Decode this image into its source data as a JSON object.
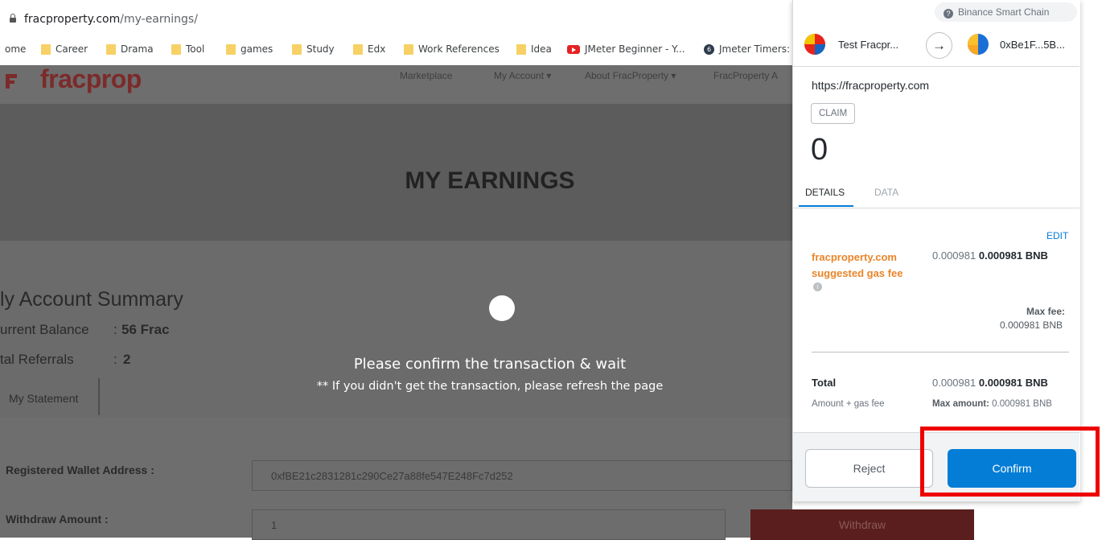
{
  "browser": {
    "url_host": "fracproperty.com",
    "url_path": "/my-earnings/",
    "bookmarks": [
      "ome",
      "Career",
      "Drama",
      "Tool",
      "games",
      "Study",
      "Edx",
      "Work References",
      "Idea",
      "JMeter Beginner - Y...",
      "Jmeter Timers:"
    ]
  },
  "site": {
    "logo": "fracprop",
    "nav": [
      "Marketplace",
      "My Account ▾",
      "About FracProperty ▾",
      "FracProperty A"
    ],
    "title": "MY EARNINGS",
    "summary_title": "ly Account Summary",
    "balance_label": "urrent Balance",
    "balance_value": "56 Frac",
    "referrals_label": "tal Referrals",
    "referrals_value": "2",
    "statement_tab": "My Statement",
    "wallet_label": "Registered Wallet Address  :",
    "wallet_value": "0xfBE21c2831281c290Ce27a88fe547E248Fc7d252",
    "withdraw_label": "Withdraw Amount  :",
    "withdraw_value": "1",
    "withdraw_button": "Withdraw",
    "confirm_message": "Please confirm the transaction & wait",
    "confirm_note": "** If you didn't get the transaction, please refresh the page"
  },
  "wallet": {
    "network": "Binance Smart Chain",
    "from_account": "Test Fracpr...",
    "to_account": "0xBe1F...5B...",
    "origin": "https://fracproperty.com",
    "method": "CLAIM",
    "amount": "0",
    "tab_details": "DETAILS",
    "tab_data": "DATA",
    "edit": "EDIT",
    "gas_label_1": "fracproperty.com",
    "gas_label_2": "suggested gas fee",
    "gas_value_muted": "0.000981",
    "gas_value_bold": "0.000981 BNB",
    "max_fee_label": "Max fee:",
    "max_fee_value": "0.000981 BNB",
    "total_label": "Total",
    "total_value_muted": "0.000981",
    "total_value_bold": "0.000981 BNB",
    "amount_gas_label": "Amount + gas fee",
    "max_amount_label": "Max amount:",
    "max_amount_value": "0.000981 BNB",
    "reject": "Reject",
    "confirm": "Confirm"
  },
  "colors": {
    "accent": "#037dd6",
    "gas_label": "#e98529",
    "highlight": "#ee0000",
    "logo": "#7c2a2a"
  }
}
